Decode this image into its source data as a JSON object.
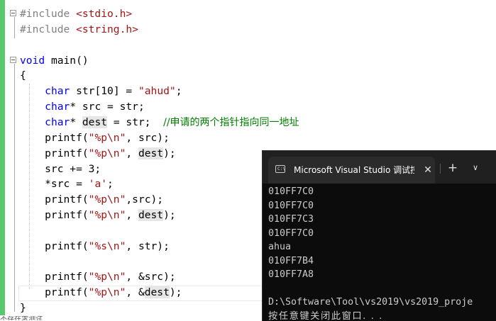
{
  "editor": {
    "lines": [
      {
        "parts": [
          {
            "t": "#include ",
            "c": "pp"
          },
          {
            "t": "<stdio.h>",
            "c": "str"
          }
        ]
      },
      {
        "parts": [
          {
            "t": "#include ",
            "c": "pp"
          },
          {
            "t": "<string.h>",
            "c": "str"
          }
        ]
      },
      {
        "parts": []
      },
      {
        "parts": [
          {
            "t": "void",
            "c": "kw"
          },
          {
            "t": " main()",
            "c": "fn"
          }
        ]
      },
      {
        "parts": [
          {
            "t": "{",
            "c": "fn"
          }
        ]
      },
      {
        "parts": [
          {
            "t": "    "
          },
          {
            "t": "char",
            "c": "kw"
          },
          {
            "t": " str[10] = "
          },
          {
            "t": "\"ahud\"",
            "c": "str"
          },
          {
            "t": ";"
          }
        ]
      },
      {
        "parts": [
          {
            "t": "    "
          },
          {
            "t": "char",
            "c": "kw"
          },
          {
            "t": "* src = str;"
          }
        ]
      },
      {
        "parts": [
          {
            "t": "    "
          },
          {
            "t": "char",
            "c": "kw"
          },
          {
            "t": "* "
          },
          {
            "t": "dest",
            "c": "hl"
          },
          {
            "t": " = str;  "
          },
          {
            "t": "//申请的两个指针指向同一地址",
            "c": "cmt"
          }
        ]
      },
      {
        "parts": [
          {
            "t": "    printf("
          },
          {
            "t": "\"%p\\n\"",
            "c": "str"
          },
          {
            "t": ", src);"
          }
        ]
      },
      {
        "parts": [
          {
            "t": "    printf("
          },
          {
            "t": "\"%p\\n\"",
            "c": "str"
          },
          {
            "t": ", "
          },
          {
            "t": "dest",
            "c": "hl"
          },
          {
            "t": ");"
          }
        ]
      },
      {
        "parts": [
          {
            "t": "    src += 3;"
          }
        ]
      },
      {
        "parts": [
          {
            "t": "    *src = "
          },
          {
            "t": "'a'",
            "c": "str"
          },
          {
            "t": ";"
          }
        ]
      },
      {
        "parts": [
          {
            "t": "    printf("
          },
          {
            "t": "\"%p\\n\"",
            "c": "str"
          },
          {
            "t": ",src);"
          }
        ]
      },
      {
        "parts": [
          {
            "t": "    printf("
          },
          {
            "t": "\"%p\\n\"",
            "c": "str"
          },
          {
            "t": ", "
          },
          {
            "t": "dest",
            "c": "hl"
          },
          {
            "t": ");"
          }
        ]
      },
      {
        "parts": []
      },
      {
        "parts": [
          {
            "t": "    printf("
          },
          {
            "t": "\"%s\\n\"",
            "c": "str"
          },
          {
            "t": ", str);"
          }
        ]
      },
      {
        "parts": []
      },
      {
        "parts": [
          {
            "t": "    printf("
          },
          {
            "t": "\"%p\\n\"",
            "c": "str"
          },
          {
            "t": ", &src);"
          }
        ]
      },
      {
        "parts": [
          {
            "t": "    printf("
          },
          {
            "t": "\"%p\\n\"",
            "c": "str"
          },
          {
            "t": ", &"
          },
          {
            "t": "dest",
            "c": "hl"
          },
          {
            "t": ");"
          }
        ]
      },
      {
        "parts": [
          {
            "t": "}"
          }
        ]
      }
    ],
    "status_snippet": "不存在求测试"
  },
  "terminal": {
    "tab_title": "Microsoft Visual Studio 调试控制台",
    "tab_icon_text": "C:\\",
    "close_glyph": "✕",
    "new_tab_glyph": "+",
    "dropdown_glyph": "∨",
    "output": [
      "010FF7C0",
      "010FF7C0",
      "010FF7C3",
      "010FF7C0",
      "ahua",
      "010FF7B4",
      "010FF7A8",
      "",
      "D:\\Software\\Tool\\vs2019\\vs2019_proje",
      "按任意键关闭此窗口. . ."
    ]
  }
}
